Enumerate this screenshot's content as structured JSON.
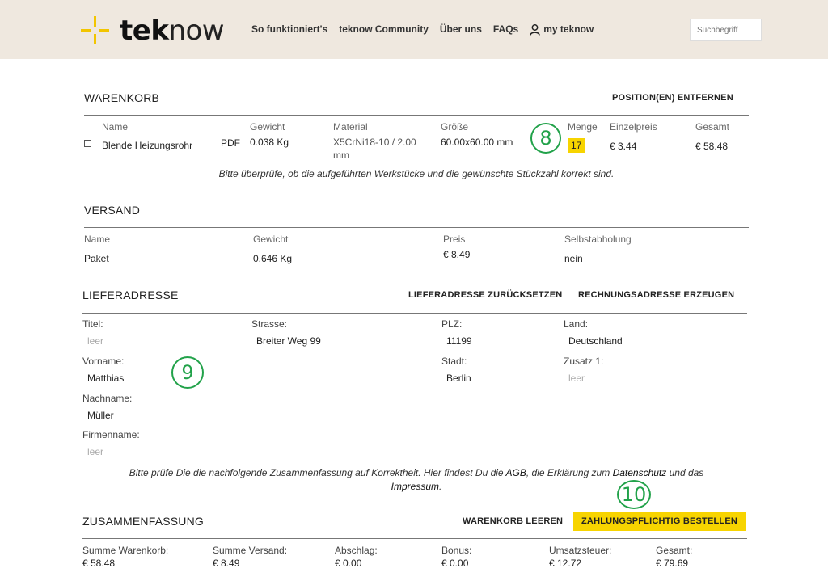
{
  "header": {
    "logo": {
      "bold": "tek",
      "light": "now"
    },
    "nav": [
      "So funktioniert's",
      "teknow Community",
      "Über uns",
      "FAQs"
    ],
    "account": "my teknow",
    "search_placeholder": "Suchbegriff"
  },
  "cart": {
    "title": "WARENKORB",
    "action": "POSITION(EN) ENTFERNEN",
    "headers": {
      "name": "Name",
      "weight": "Gewicht",
      "material": "Material",
      "size": "Größe",
      "qty": "Menge",
      "unit": "Einzelpreis",
      "total": "Gesamt"
    },
    "item": {
      "name": "Blende Heizungsrohr",
      "pdf": "PDF",
      "weight": "0.038 Kg",
      "material_line1": "X5CrNi18-10 / 2.00",
      "material_line2": "mm",
      "size": "60.00x60.00 mm",
      "qty": "17",
      "unit": "€ 3.44",
      "total": "€ 58.48"
    },
    "note": "Bitte überprüfe, ob die aufgeführten Werkstücke und die gewünschte Stückzahl korrekt sind."
  },
  "shipping": {
    "title": "VERSAND",
    "headers": {
      "name": "Name",
      "weight": "Gewicht",
      "price": "Preis",
      "pickup": "Selbstabholung"
    },
    "row": {
      "name": "Paket",
      "weight": "0.646 Kg",
      "price": "€ 8.49",
      "pickup": "nein"
    }
  },
  "address": {
    "title": "LIEFERADRESSE",
    "reset": "LIEFERADRESSE ZURÜCKSETZEN",
    "billing": "RECHNUNGSADRESSE ERZEUGEN",
    "fields": {
      "title_lbl": "Titel:",
      "title_val": "leer",
      "first_lbl": "Vorname:",
      "first_val": "Matthias",
      "last_lbl": "Nachname:",
      "last_val": "Müller",
      "company_lbl": "Firmenname:",
      "company_val": "leer",
      "street_lbl": "Strasse:",
      "street_val": "Breiter Weg 99",
      "zip_lbl": "PLZ:",
      "zip_val": "11199",
      "city_lbl": "Stadt:",
      "city_val": "Berlin",
      "country_lbl": "Land:",
      "country_val": "Deutschland",
      "extra_lbl": "Zusatz 1:",
      "extra_val": "leer"
    },
    "note_a": "Bitte prüfe Die die nachfolgende Zusammenfassung auf Korrektheit. Hier findest Du die ",
    "note_agb": "AGB",
    "note_b": ", die Erklärung zum ",
    "note_privacy": "Datenschutz",
    "note_c": " und das",
    "note_imprint": "Impressum",
    "note_d": "."
  },
  "summary": {
    "title": "ZUSAMMENFASSUNG",
    "clear": "WARENKORB LEEREN",
    "order": "ZAHLUNGSPFLICHTIG BESTELLEN",
    "cols": [
      {
        "lbl": "Summe Warenkorb:",
        "val": "€ 58.48"
      },
      {
        "lbl": "Summe Versand:",
        "val": "€ 8.49"
      },
      {
        "lbl": "Abschlag:",
        "val": "€ 0.00"
      },
      {
        "lbl": "Bonus:",
        "val": "€ 0.00"
      },
      {
        "lbl": "Umsatzsteuer:",
        "val": "€ 12.72"
      },
      {
        "lbl": "Gesamt:",
        "val": "€ 79.69"
      }
    ]
  },
  "markers": [
    "8",
    "9",
    "10"
  ],
  "colors": {
    "header_bg": "#efe8df",
    "accent_yellow": "#f7d400",
    "marker_green": "#22a24a"
  }
}
